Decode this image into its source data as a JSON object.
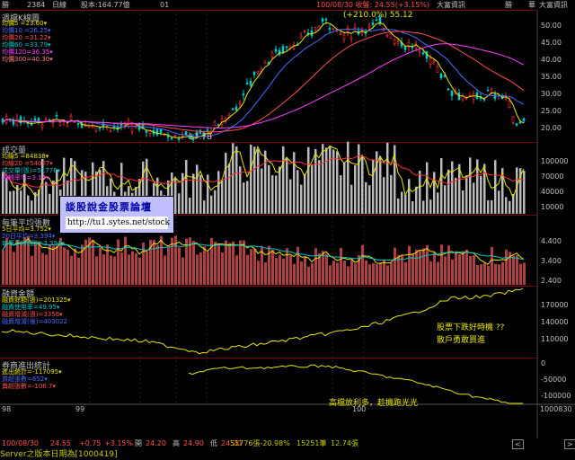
{
  "topbar": {
    "code_label": "勝",
    "code": "2384",
    "period": "日線",
    "capital": "股本:164.77億",
    "group": "01",
    "date_info": "100/08/30 收盤: 24.55(+3.15%)",
    "name": "大富資訊",
    "right1": "勝",
    "right2": "華",
    "right3": "大富資訊"
  },
  "panel1": {
    "title": "週檔K線圖",
    "legend": [
      "均價5 =23.60▾",
      "均價10 =26.25▾",
      "均價20 =31.22▾",
      "均價60 =33.79▾",
      "均價120=36.35▾",
      "均價300=40.30▾"
    ],
    "ticks": [
      "50.00",
      "45.00",
      "40.00",
      "35.00",
      "30.00",
      "25.00",
      "20.00"
    ],
    "high_label": "(+210.0%) 55.12",
    "low_label": "17.78"
  },
  "panel2": {
    "title": "成交量",
    "legend": [
      "均線5 =84838▾",
      "均線20 =54007▾",
      "成交量(張)=51776▾",
      "週轉率%=3.14▾"
    ],
    "ticks": [
      "100000",
      "70000",
      "40000",
      "10000"
    ]
  },
  "panel3": {
    "title": "每筆平均張數",
    "legend": [
      "5日平均=3.752▾",
      "20日平均=3.394▾",
      "每筆平均(張)=3.394▾"
    ],
    "ticks": [
      "4.400",
      "3.400",
      "2.400"
    ]
  },
  "panel4": {
    "title": "融資金額",
    "legend": [
      "融資餘額(張)=201325▾",
      "融資使用率=49.95▾",
      "融資增減(張)=3356▾",
      "融資增減(億)=403022"
    ],
    "ticks": [
      "170000",
      "140000",
      "110000"
    ],
    "annotation_line1": "股票下跌好時機 ??",
    "annotation_line2": "散戶勇敢買進"
  },
  "panel5": {
    "title": "券商進出統計",
    "legend": [
      "進出統計=-117095▾",
      "買超張數=652▾",
      "賣超張數=-106.7▾"
    ],
    "ticks": [
      "0",
      "-50000",
      "-100000"
    ],
    "annotation": "高檔放利多，趁機跑光光"
  },
  "xdates": [
    "98",
    "99",
    "100"
  ],
  "xright": "1000830",
  "bottombar": {
    "date": "100/08/30",
    "price": "24.55",
    "change": "+0.75",
    "pct": "+3.15%",
    "open_lbl": "開",
    "open": "24.20",
    "high_lbl": "高",
    "high": "24.90",
    "low_lbl": "低",
    "low": "24.20",
    "vol": "51776張-20.98%",
    "trades": "15251筆",
    "avg": "12.74張"
  },
  "forum": {
    "title": "談股說金股票論壇",
    "url": "http://tu1.sytes.net/stock"
  },
  "status": "Server之版本日期為[1000419]",
  "colors": {
    "bull": "#ff3030",
    "bear": "#00c8c8",
    "ma_yellow": "#e6e600",
    "ma_blue": "#4a6bff",
    "ma_red": "#ff5050",
    "ma_pink": "#ff40ff",
    "volume_bar": "#b9b9b9",
    "avg_bar": "#b04040"
  }
}
